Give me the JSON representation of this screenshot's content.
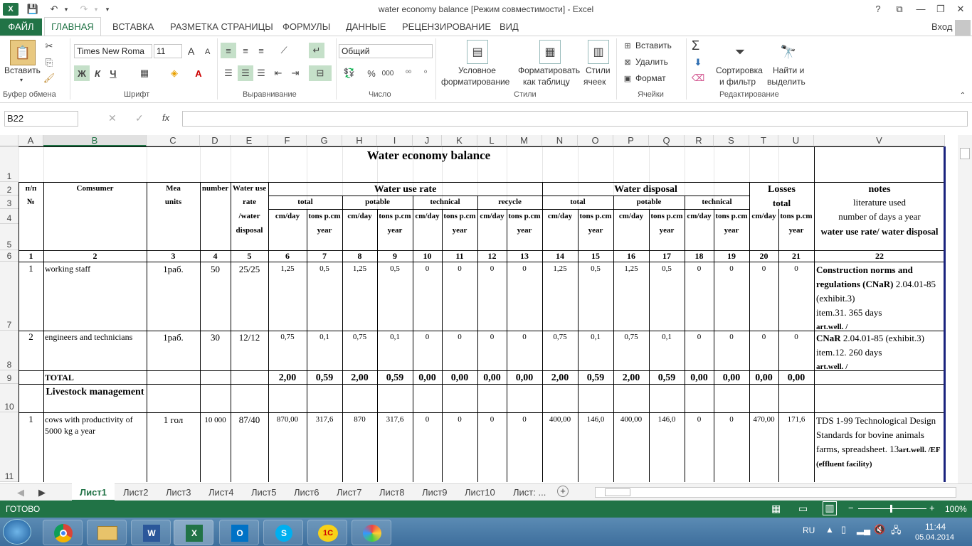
{
  "window": {
    "title": "water economy balance  [Режим совместимости] - Excel",
    "help": "?",
    "restore_ribbon": "⧉",
    "minimize": "—",
    "maximize": "❐",
    "close": "✕",
    "signin": "Вход"
  },
  "ribbon_tabs": {
    "file": "ФАЙЛ",
    "home": "ГЛАВНАЯ",
    "insert": "ВСТАВКА",
    "layout": "РАЗМЕТКА СТРАНИЦЫ",
    "formulas": "ФОРМУЛЫ",
    "data": "ДАННЫЕ",
    "review": "РЕЦЕНЗИРОВАНИЕ",
    "view": "ВИД"
  },
  "clipboard": {
    "paste": "Вставить",
    "label": "Буфер обмена"
  },
  "font": {
    "name": "Times New Roma",
    "size": "11",
    "bold": "Ж",
    "italic": "К",
    "underline": "Ч",
    "grow": "A",
    "shrink": "A",
    "label": "Шрифт"
  },
  "alignment": {
    "label": "Выравнивание"
  },
  "number": {
    "format": "Общий",
    "percent": "%",
    "thousands": "000",
    "label": "Число"
  },
  "styles": {
    "conditional_1": "Условное",
    "conditional_2": "форматирование",
    "table_1": "Форматировать",
    "table_2": "как таблицу",
    "cell_1": "Стили",
    "cell_2": "ячеек",
    "label": "Стили"
  },
  "cells": {
    "insert": "Вставить",
    "delete": "Удалить",
    "format": "Формат",
    "label": "Ячейки"
  },
  "editing": {
    "sigma": "Σ",
    "sort_1": "Сортировка",
    "sort_2": "и фильтр",
    "find_1": "Найти и",
    "find_2": "выделить",
    "label": "Редактирование"
  },
  "formula_bar": {
    "name_box": "B22",
    "fx": "fx",
    "cancel": "✕",
    "enter": "✓",
    "value": ""
  },
  "columns": [
    "A",
    "B",
    "C",
    "D",
    "E",
    "F",
    "G",
    "H",
    "I",
    "J",
    "K",
    "L",
    "M",
    "N",
    "O",
    "P",
    "Q",
    "R",
    "S",
    "T",
    "U",
    "V"
  ],
  "rows": [
    "1",
    "2",
    "3",
    "4",
    "5",
    "6",
    "7",
    "8",
    "9",
    "10",
    "11"
  ],
  "sheet": {
    "title": "Water economy balance",
    "h_num": "п/п",
    "h_no": "№",
    "h_consumer": "Comsumer",
    "h_mea": "Mea",
    "h_units": "units",
    "h_number": "number",
    "h_rate1": "Water use",
    "h_rate2": "rate",
    "h_rate3": "/water",
    "h_rate4": "disposal",
    "h_wur": "Water use rate",
    "h_wd": "Water disposal",
    "h_losses": "Losses",
    "h_notes": "notes",
    "h_total": "total",
    "h_potable": "potable",
    "h_technical": "technical",
    "h_recycle": "recycle",
    "h_total2": "total",
    "h_potable2": "potable",
    "h_technical2": "technical",
    "h_losses_total": "total",
    "h_lit": "literature used",
    "h_days": "number of days a year",
    "h_rate_notes": "water use rate/ water disposal",
    "u_cmday": "cm/day",
    "u_tons": "tons p.cm",
    "u_year": "year",
    "colnums": [
      "1",
      "2",
      "3",
      "4",
      "5",
      "6",
      "7",
      "8",
      "9",
      "10",
      "11",
      "12",
      "13",
      "14",
      "15",
      "16",
      "17",
      "18",
      "19",
      "20",
      "21",
      "22"
    ],
    "r1": {
      "no": "1",
      "consumer": "working staff",
      "units": "1раб.",
      "number": "50",
      "rate": "25/25",
      "vals": [
        "1,25",
        "0,5",
        "1,25",
        "0,5",
        "0",
        "0",
        "0",
        "0",
        "1,25",
        "0,5",
        "1,25",
        "0,5",
        "0",
        "0",
        "0",
        "0"
      ],
      "note_b": "Construction norms and regulations (CNaR)",
      "note_n": " 2.04.01-85  (exhibit.3)",
      "note_item": "item.31. 365 days",
      "note_art": "art.well. /"
    },
    "r2": {
      "no": "2",
      "consumer": "engineers and technicians",
      "units": "1раб.",
      "number": "30",
      "rate": "12/12",
      "vals": [
        "0,75",
        "0,1",
        "0,75",
        "0,1",
        "0",
        "0",
        "0",
        "0",
        "0,75",
        "0,1",
        "0,75",
        "0,1",
        "0",
        "0",
        "0",
        "0"
      ],
      "note_b": "CNaR",
      "note_n": " 2.04.01-85  (exhibit.3)",
      "note_item": "item.12.  260 days",
      "note_art": "art.well. /"
    },
    "total": {
      "label": "TOTAL",
      "vals": [
        "2,00",
        "0,59",
        "2,00",
        "0,59",
        "0,00",
        "0,00",
        "0,00",
        "0,00",
        "2,00",
        "0,59",
        "2,00",
        "0,59",
        "0,00",
        "0,00",
        "0,00",
        "0,00"
      ]
    },
    "livestock": "Livestock management",
    "r3": {
      "no": "1",
      "consumer": "cows with productivity of 5000 kg a year",
      "units": "1 гол",
      "number": "10 000",
      "rate": "87/40",
      "vals": [
        "870,00",
        "317,6",
        "870",
        "317,6",
        "0",
        "0",
        "0",
        "0",
        "400,00",
        "146,0",
        "400,00",
        "146,0",
        "0",
        "0",
        "470,00",
        "171,6"
      ],
      "note1": " TDS 1-99 Technological Design Standards for bovine animals farms, spreadsheet. 13",
      "note_art": "art.well. /EF",
      "note_ef": "(effluent facility)"
    }
  },
  "sheet_tabs": [
    "Лист1",
    "Лист2",
    "Лист3",
    "Лист4",
    "Лист5",
    "Лист6",
    "Лист7",
    "Лист8",
    "Лист9",
    "Лист10",
    "Лист: ..."
  ],
  "status": {
    "ready": "ГОТОВО",
    "zoom": "100%"
  },
  "tray": {
    "lang": "RU",
    "time": "11:44",
    "date": "05.04.2014"
  }
}
